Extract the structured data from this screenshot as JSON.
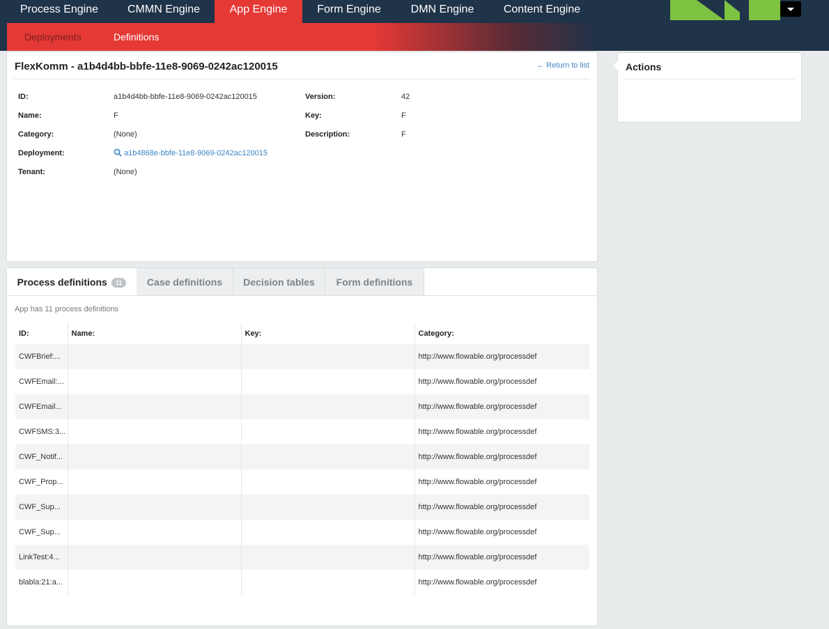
{
  "engine_tabs": [
    {
      "label": "Process Engine"
    },
    {
      "label": "CMMN Engine"
    },
    {
      "label": "App Engine"
    },
    {
      "label": "Form Engine"
    },
    {
      "label": "DMN Engine"
    },
    {
      "label": "Content Engine"
    }
  ],
  "active_engine_tab": "App Engine",
  "subnav": {
    "deployments": "Deployments",
    "definitions": "Definitions"
  },
  "detail": {
    "title": "FlexKomm - a1b4d4bb-bbfe-11e8-9069-0242ac120015",
    "return_link": "← Return to list",
    "fields": {
      "id_label": "ID:",
      "id_value": "a1b4d4bb-bbfe-11e8-9069-0242ac120015",
      "name_label": "Name:",
      "name_value": "F",
      "category_label": "Category:",
      "category_value": "(None)",
      "deployment_label": "Deployment:",
      "deployment_value": "a1b4868e-bbfe-11e8-9069-0242ac120015",
      "tenant_label": "Tenant:",
      "tenant_value": "(None)",
      "version_label": "Version:",
      "version_value": "42",
      "key_label": "Key:",
      "key_value": "F",
      "description_label": "Description:",
      "description_value": "F"
    }
  },
  "actions": {
    "title": "Actions"
  },
  "definition_tabs": {
    "process": "Process definitions",
    "process_count": "11",
    "case": "Case definitions",
    "decision": "Decision tables",
    "form": "Form definitions"
  },
  "process_defs": {
    "summary": "App has 11 process definitions",
    "columns": [
      "ID:",
      "Name:",
      "Key:",
      "Category:"
    ],
    "rows": [
      {
        "id": "CWFBrief:...",
        "name": "",
        "key": "",
        "category": "http://www.flowable.org/processdef"
      },
      {
        "id": "CWFEmail:...",
        "name": "",
        "key": "",
        "category": "http://www.flowable.org/processdef"
      },
      {
        "id": "CWFEmail...",
        "name": "",
        "key": "",
        "category": "http://www.flowable.org/processdef"
      },
      {
        "id": "CWFSMS:3...",
        "name": "",
        "key": "",
        "category": "http://www.flowable.org/processdef"
      },
      {
        "id": "CWF_Notif...",
        "name": "",
        "key": "",
        "category": "http://www.flowable.org/processdef"
      },
      {
        "id": "CWF_Prop...",
        "name": "",
        "key": "",
        "category": "http://www.flowable.org/processdef"
      },
      {
        "id": "CWF_Sup...",
        "name": "",
        "key": "",
        "category": "http://www.flowable.org/processdef"
      },
      {
        "id": "CWF_Sup...",
        "name": "",
        "key": "",
        "category": "http://www.flowable.org/processdef"
      },
      {
        "id": "LinkTest:4...",
        "name": "",
        "key": "",
        "category": "http://www.flowable.org/processdef"
      },
      {
        "id": "blabla:21:a...",
        "name": "",
        "key": "",
        "category": "http://www.flowable.org/processdef"
      }
    ]
  },
  "colors": {
    "navbar": "#1f3349",
    "accent_red": "#e53935",
    "link_blue": "#3b83c5",
    "logo_green": "#7ec242"
  }
}
